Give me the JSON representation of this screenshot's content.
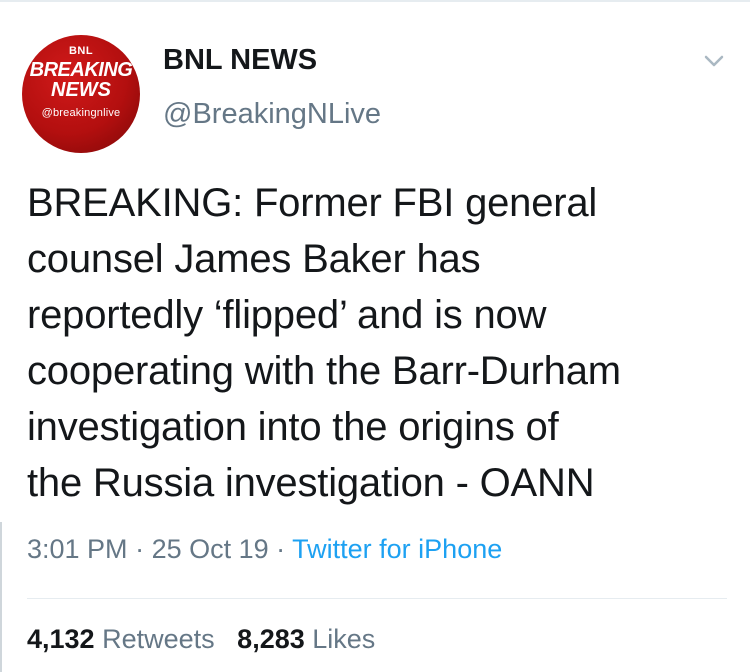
{
  "avatar": {
    "top_text": "BNL",
    "line1": "BREAKING",
    "line2": "NEWS",
    "handle_text": "@breakingnlive"
  },
  "author": {
    "display_name": "BNL NEWS",
    "handle": "@BreakingNLive"
  },
  "tweet": {
    "text": "BREAKING: Former FBI general\ncounsel James Baker has\nreportedly ‘flipped’ and is now\ncooperating with the Barr-Durham\ninvestigation into the origins of\nthe Russia investigation - OANN"
  },
  "meta": {
    "time": "3:01 PM",
    "separator1": " · ",
    "date": "25 Oct 19",
    "separator2": " · ",
    "source": "Twitter for iPhone"
  },
  "stats": {
    "retweets_count": "4,132",
    "retweets_label": "Retweets",
    "likes_count": "8,283",
    "likes_label": "Likes"
  },
  "icons": {
    "caret": "chevron-down-icon"
  },
  "colors": {
    "text_primary": "#14171a",
    "text_secondary": "#657786",
    "link": "#1da1f2",
    "avatar_red": "#b30f0f",
    "divider": "#e6ecf0"
  }
}
